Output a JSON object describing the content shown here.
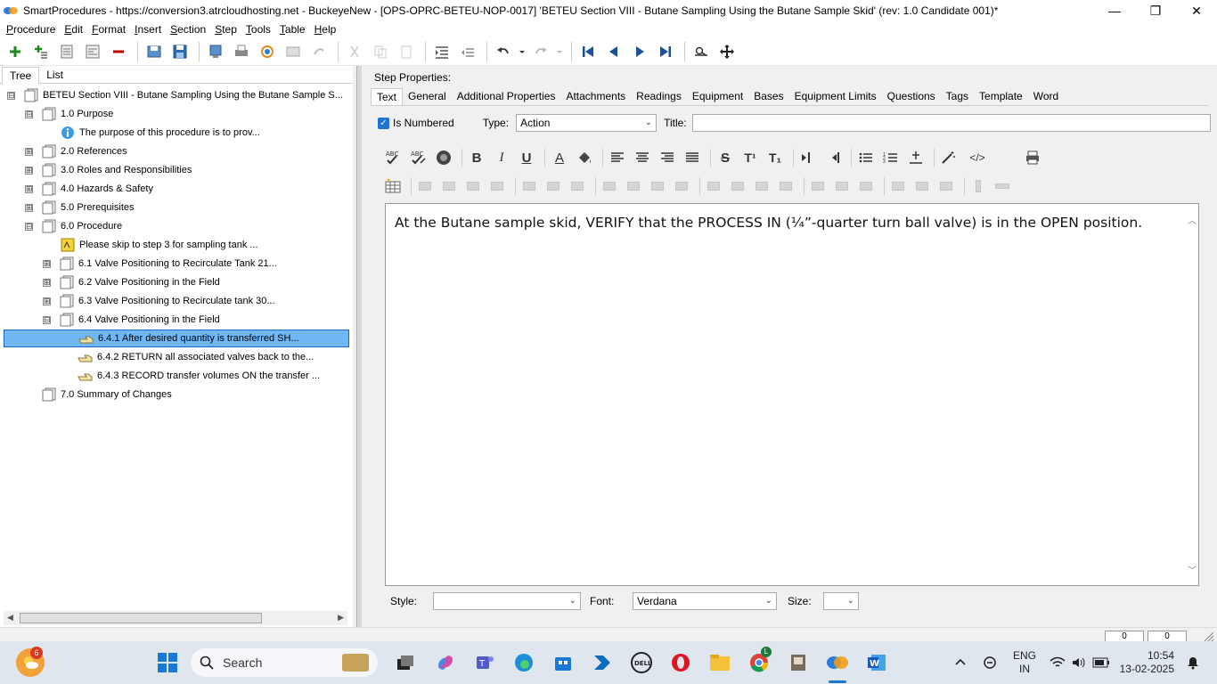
{
  "window": {
    "title": "SmartProcedures - https://conversion3.atrcloudhosting.net - BuckeyeNew - [OPS-OPRC-BETEU-NOP-0017] 'BETEU Section VIII - Butane Sampling Using the Butane Sample Skid' (rev: 1.0 Candidate 001)*",
    "minimize": "—",
    "maximize": "❐",
    "close": "✕"
  },
  "menu": [
    {
      "first": "P",
      "rest": "rocedure"
    },
    {
      "first": "E",
      "rest": "dit"
    },
    {
      "first": "F",
      "rest": "ormat"
    },
    {
      "first": "I",
      "rest": "nsert"
    },
    {
      "first": "S",
      "rest": "ection"
    },
    {
      "first": "S",
      "rest": "tep"
    },
    {
      "first": "T",
      "rest": "ools"
    },
    {
      "first": "T",
      "rest": "able"
    },
    {
      "first": "H",
      "rest": "elp"
    }
  ],
  "left_tabs": {
    "tree": "Tree",
    "list": "List"
  },
  "tree": [
    {
      "label": "BETEU Section VIII - Butane Sampling Using the Butane Sample S...",
      "exp": "⊟"
    },
    {
      "label": "1.0 Purpose",
      "exp": "⊟"
    },
    {
      "label": "The purpose of this procedure is to prov..."
    },
    {
      "label": "2.0 References",
      "exp": "⊞"
    },
    {
      "label": "3.0 Roles and Responsibilities",
      "exp": "⊞"
    },
    {
      "label": "4.0 Hazards & Safety",
      "exp": "⊞"
    },
    {
      "label": "5.0 Prerequisites",
      "exp": "⊞"
    },
    {
      "label": "6.0 Procedure",
      "exp": "⊟"
    },
    {
      "label": "Please skip to step 3 for sampling tank ..."
    },
    {
      "label": "6.1 Valve Positioning to Recirculate Tank 21...",
      "exp": "⊞"
    },
    {
      "label": "6.2 Valve Positioning in the Field",
      "exp": "⊞"
    },
    {
      "label": "6.3 Valve Positioning to Recirculate tank 30...",
      "exp": "⊞"
    },
    {
      "label": "6.4 Valve Positioning in the Field",
      "exp": "⊟"
    },
    {
      "label": "6.4.1 After desired quantity is transferred SH..."
    },
    {
      "label": "6.4.2 RETURN all associated valves back to the..."
    },
    {
      "label": "6.4.3 RECORD transfer volumes ON the transfer ..."
    },
    {
      "label": "7.0 Summary of Changes"
    }
  ],
  "step_properties_label": "Step Properties:",
  "right_tabs": [
    "Text",
    "General",
    "Additional Properties",
    "Attachments",
    "Readings",
    "Equipment",
    "Bases",
    "Equipment Limits",
    "Questions",
    "Tags",
    "Template",
    "Word"
  ],
  "props": {
    "is_numbered": "Is Numbered",
    "type_label": "Type:",
    "type_value": "Action",
    "title_label": "Title:"
  },
  "format_buttons": {
    "bold": "B",
    "italic": "I",
    "underline": "U",
    "font_color": "A",
    "strike": "S",
    "superscript": "T¹",
    "subscript": "T₁",
    "html": "</>"
  },
  "editor": {
    "text": "At the Butane sample skid, VERIFY that the PROCESS IN (¼”-quarter turn ball valve) is in the OPEN position."
  },
  "bottom": {
    "style_label": "Style:",
    "style_value": "",
    "font_label": "Font:",
    "font_value": "Verdana",
    "size_label": "Size:",
    "size_value": ""
  },
  "statusbar": {
    "box1": "0",
    "box2": "0"
  },
  "taskbar": {
    "notification_count": "6",
    "search_placeholder": "Search",
    "chrome_badge": "L",
    "lang": "ENG",
    "region": "IN",
    "time": "10:54",
    "date": "13-02-2025"
  }
}
